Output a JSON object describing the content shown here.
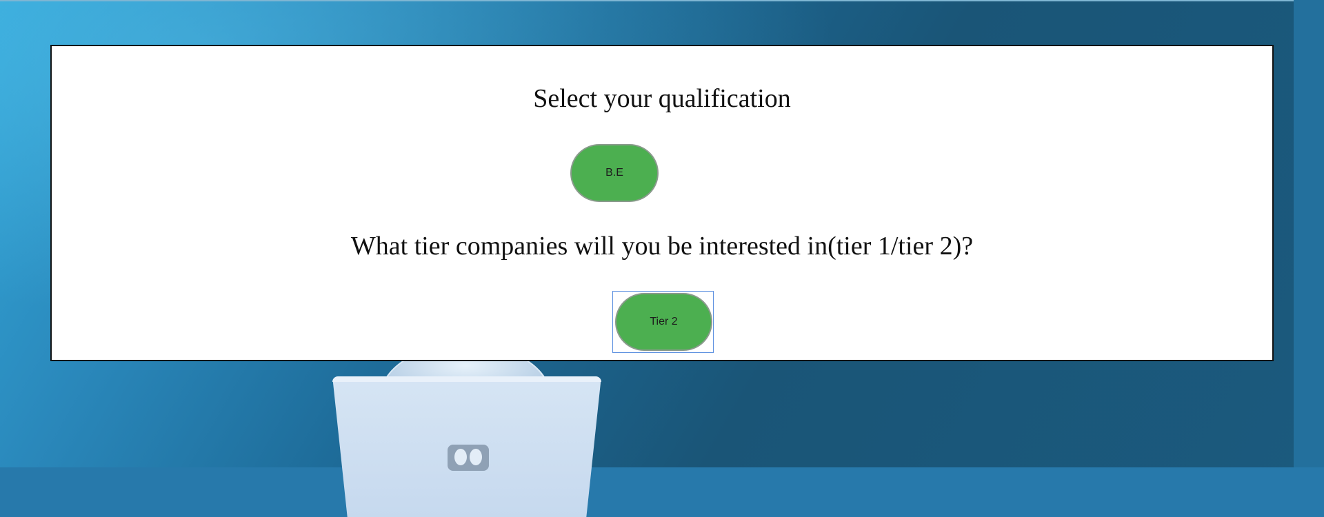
{
  "survey": {
    "question_1": "Select your qualification",
    "answer_1": "B.E",
    "question_2": "What tier companies will you be interested in(tier 1/tier 2)?",
    "answer_2": "Tier 2"
  },
  "colors": {
    "button_green": "#4caf50",
    "panel_background": "#ffffff",
    "backdrop_blue": "#1b5a7f",
    "selection_outline": "#5b8fe0"
  },
  "icons": {
    "illustration": "robot-with-laptop-illustration"
  }
}
